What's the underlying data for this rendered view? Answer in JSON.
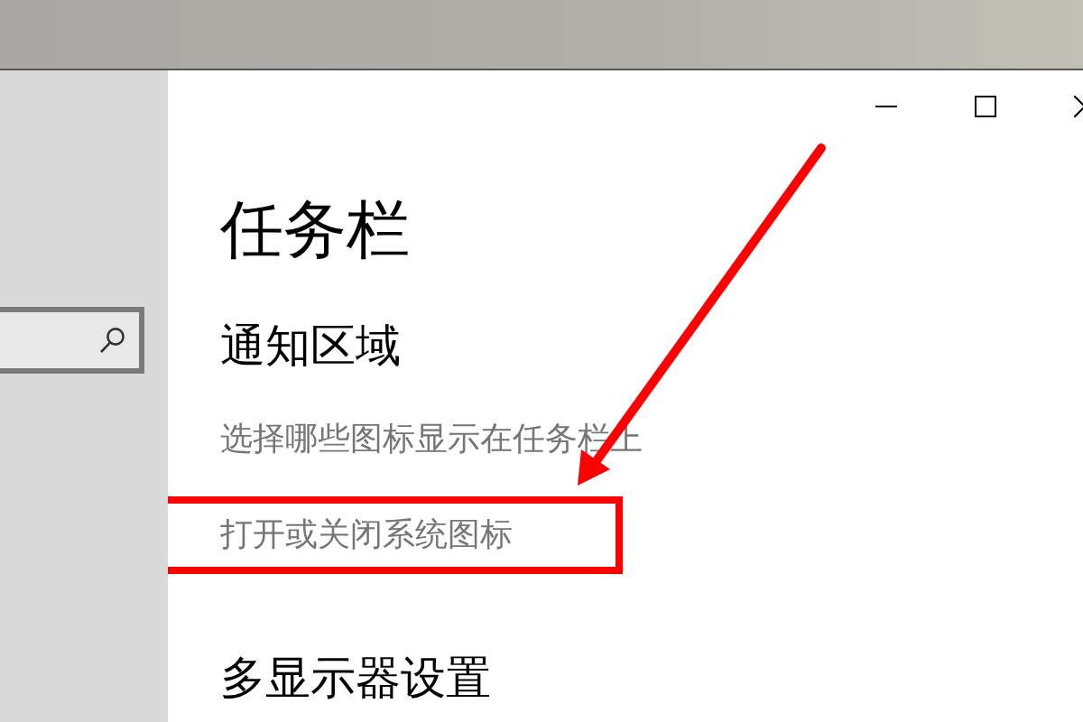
{
  "page_title": "任务栏",
  "sections": [
    {
      "heading": "通知区域",
      "links": [
        {
          "text": "选择哪些图标显示在任务栏上",
          "highlighted": false
        },
        {
          "text": "打开或关闭系统图标",
          "highlighted": true
        }
      ]
    },
    {
      "heading": "多显示器设置"
    }
  ]
}
